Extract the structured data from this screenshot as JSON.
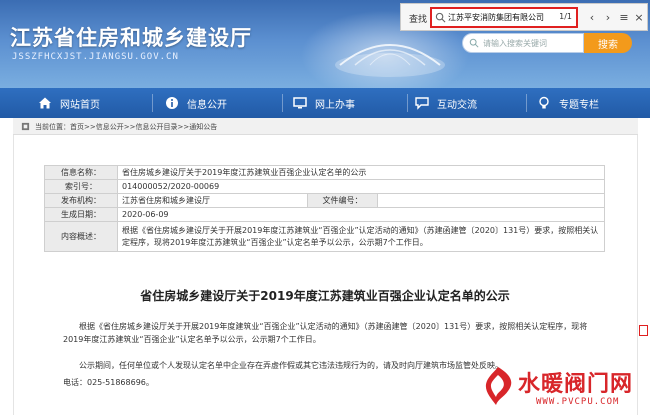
{
  "header": {
    "site_title": "江苏省住房和城乡建设厅",
    "site_domain": "JSSZFHCXJST.JIANGSU.GOV.CN"
  },
  "find_bar": {
    "label": "查找",
    "query": "江苏平安消防集团有限公司",
    "match_count": "1/1"
  },
  "search": {
    "placeholder": "请输入搜索关键词",
    "button": "搜索"
  },
  "nav": {
    "items": [
      {
        "label": "网站首页",
        "icon": "home-icon"
      },
      {
        "label": "信息公开",
        "icon": "info-icon"
      },
      {
        "label": "网上办事",
        "icon": "monitor-icon"
      },
      {
        "label": "互动交流",
        "icon": "chat-icon"
      },
      {
        "label": "专题专栏",
        "icon": "bulb-icon"
      }
    ]
  },
  "breadcrumb": "当前位置：首页>>信息公开>>信息公开目录>>通知公告",
  "info_table": {
    "name_key": "信息名称：",
    "name_val": "省住房城乡建设厅关于2019年度江苏建筑业百强企业认定名单的公示",
    "index_key": "索引号：",
    "index_val": "014000052/2020-00069",
    "org_key": "发布机构：",
    "org_val": "江苏省住房和城乡建设厅",
    "docno_key": "文件编号：",
    "docno_val": "",
    "date_key": "生成日期：",
    "date_val": "2020-06-09",
    "summary_key": "内容概述：",
    "summary_val": "根据《省住房城乡建设厅关于开展2019年度江苏建筑业“百强企业”认定活动的通知》（苏建函建管〔2020〕131号）要求，按照相关认定程序，现将2019年度江苏建筑业“百强企业”认定名单予以公示，公示期7个工作日。"
  },
  "document": {
    "title": "省住房城乡建设厅关于2019年度江苏建筑业百强企业认定名单的公示",
    "para1": "根据《省住房城乡建设厅关于开展2019年度建筑业“百强企业”认定活动的通知》（苏建函建管〔2020〕131号）要求，按照相关认定程序，现将2019年度江苏建筑业“百强企业”认定名单予以公示，公示期7个工作日。",
    "para2": "公示期间，任何单位或个人发现认定名单中企业存在弄虚作假或其它违法违规行为的，请及时向厅建筑市场监管处反映。",
    "para3": "电话：025-51868696。"
  },
  "watermark": {
    "name": "水暖阀门网",
    "url": "WWW.PVCPU.COM"
  },
  "colors": {
    "header_blue": "#3b6db3",
    "nav_blue": "#215aa6",
    "search_orange": "#f39a1b",
    "highlight_red": "#e02020",
    "watermark_red": "#d8262a"
  }
}
